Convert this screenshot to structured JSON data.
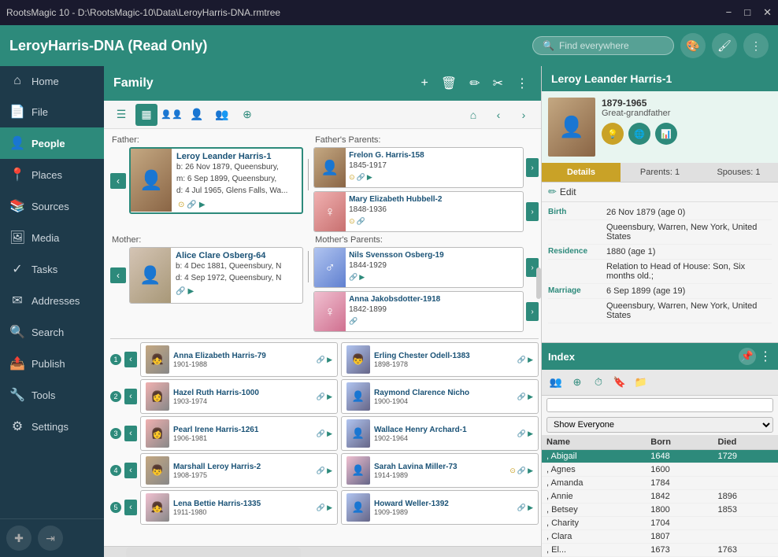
{
  "titlebar": {
    "title": "RootsMagic 10 - D:\\RootsMagic-10\\Data\\LeroyHarris-DNA.rmtree",
    "min_label": "−",
    "max_label": "□",
    "close_label": "✕"
  },
  "appheader": {
    "title": "LeroyHarris-DNA (Read Only)",
    "search_placeholder": "Find everywhere",
    "icon_emoji": "🎨",
    "icon_brush": "🖌",
    "icon_menu": "⋮"
  },
  "sidebar": {
    "items": [
      {
        "id": "home",
        "label": "Home",
        "icon": "⌂"
      },
      {
        "id": "file",
        "label": "File",
        "icon": "📄"
      },
      {
        "id": "people",
        "label": "People",
        "icon": "👤",
        "active": true
      },
      {
        "id": "places",
        "label": "Places",
        "icon": "📍"
      },
      {
        "id": "sources",
        "label": "Sources",
        "icon": "📚"
      },
      {
        "id": "media",
        "label": "Media",
        "icon": "🖼"
      },
      {
        "id": "tasks",
        "label": "Tasks",
        "icon": "✓"
      },
      {
        "id": "addresses",
        "label": "Addresses",
        "icon": "✉"
      },
      {
        "id": "search",
        "label": "Search",
        "icon": "🔍"
      },
      {
        "id": "publish",
        "label": "Publish",
        "icon": "📤"
      },
      {
        "id": "tools",
        "label": "Tools",
        "icon": "🔧"
      },
      {
        "id": "settings",
        "label": "Settings",
        "icon": "⚙"
      }
    ]
  },
  "family_panel": {
    "title": "Family",
    "add_label": "+",
    "delete_label": "🗑",
    "edit_label": "✏",
    "scissors_label": "✂",
    "menu_label": "⋮",
    "toolbar_icons": [
      "🔲",
      "▦",
      "👤👤",
      "👤",
      "👥",
      "⊕"
    ],
    "home_icon": "⌂",
    "left_arrow": "‹",
    "right_arrow": "›"
  },
  "father": {
    "label": "Father:",
    "name": "Leroy Leander Harris-1",
    "birth": "b: 26 Nov 1879, Queensbury,",
    "marriage": "m: 6 Sep 1899, Queensbury,",
    "death": "d: 4 Jul 1965, Glens Falls, Wa..."
  },
  "fathers_parents": {
    "label": "Father's Parents:",
    "father": {
      "name": "Frelon G. Harris-158",
      "dates": "1845-1917"
    },
    "mother": {
      "name": "Mary Elizabeth Hubbell-2",
      "dates": "1848-1936"
    }
  },
  "mother": {
    "label": "Mother:",
    "name": "Alice Clare Osberg-64",
    "birth": "b: 4 Dec 1881, Queensbury, N",
    "death": "d: 4 Sep 1972, Queensbury, N"
  },
  "mothers_parents": {
    "label": "Mother's Parents:",
    "father": {
      "name": "Nils Svensson Osberg-19",
      "dates": "1844-1929"
    },
    "mother": {
      "name": "Anna Jakobsdotter-1918",
      "dates": "1842-1899"
    }
  },
  "children": [
    {
      "num": "1",
      "name": "Anna Elizabeth Harris-79",
      "dates": "1901-1988",
      "spouse": "Erling Chester Odell-1383",
      "spouse_dates": "1898-1978"
    },
    {
      "num": "2",
      "name": "Hazel Ruth Harris-1000",
      "dates": "1903-1974",
      "spouse": "Raymond Clarence Nicho",
      "spouse_dates": "1900-1904"
    },
    {
      "num": "3",
      "name": "Pearl Irene Harris-1261",
      "dates": "1906-1981",
      "spouse": "Wallace Henry Archard-1",
      "spouse_dates": "1902-1964"
    },
    {
      "num": "4",
      "name": "Marshall Leroy Harris-2",
      "dates": "1908-1975",
      "spouse": "Sarah Lavina Miller-73",
      "spouse_dates": "1914-1989"
    },
    {
      "num": "5",
      "name": "Lena Bettie Harris-1335",
      "dates": "1911-1980",
      "spouse": "Howard Weller-1392",
      "spouse_dates": "1909-1989"
    }
  ],
  "right_panel": {
    "person_name": "Leroy Leander Harris-1",
    "person_dates": "1879-1965",
    "person_relation": "Great-grandfather",
    "tabs": {
      "details": "Details",
      "parents": "Parents: 1",
      "spouses": "Spouses: 1"
    },
    "edit_label": "Edit",
    "facts": [
      {
        "type": "Birth",
        "value": "26 Nov 1879 (age 0)"
      },
      {
        "type": "",
        "value": "Queensbury, Warren, New York, United States"
      },
      {
        "type": "Residence",
        "value": "1880 (age 1)"
      },
      {
        "type": "",
        "value": "Relation to Head of House: Son, Six months old.;"
      },
      {
        "type": "Marriage",
        "value": "6 Sep 1899 (age 19)"
      },
      {
        "type": "",
        "value": "Queensbury, Warren, New York, United States"
      }
    ]
  },
  "index": {
    "title": "Index",
    "menu_icon": "⋮",
    "filter_label": "Show Everyone",
    "search_placeholder": "",
    "columns": {
      "name": "Name",
      "born": "Born",
      "died": "Died"
    },
    "people": [
      {
        "name": ", Abigail",
        "born": "1648",
        "died": "1729"
      },
      {
        "name": ", Agnes",
        "born": "1600",
        "died": ""
      },
      {
        "name": ", Amanda",
        "born": "1784",
        "died": ""
      },
      {
        "name": ", Annie",
        "born": "1842",
        "died": "1896"
      },
      {
        "name": ", Betsey",
        "born": "1800",
        "died": "1853"
      },
      {
        "name": ", Charity",
        "born": "1704",
        "died": ""
      },
      {
        "name": ", Clara",
        "born": "1807",
        "died": ""
      },
      {
        "name": ", El...",
        "born": "1673",
        "died": "1763"
      }
    ]
  }
}
